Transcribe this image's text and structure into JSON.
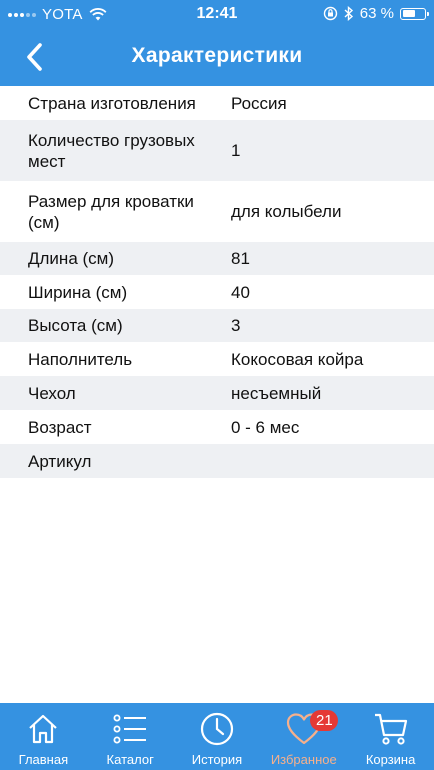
{
  "status_bar": {
    "carrier": "YOTA",
    "time": "12:41",
    "battery_percent": "63 %",
    "battery_level": 0.63
  },
  "header": {
    "title": "Характеристики"
  },
  "specs": [
    {
      "label": "Страна изготовления",
      "value": "Россия"
    },
    {
      "label": "Количество грузовых мест",
      "value": "1"
    },
    {
      "label": "Размер для кроватки (см)",
      "value": "для колыбели"
    },
    {
      "label": "Длина (см)",
      "value": "81"
    },
    {
      "label": "Ширина (см)",
      "value": "40"
    },
    {
      "label": "Высота (см)",
      "value": "3"
    },
    {
      "label": "Наполнитель",
      "value": "Кокосовая койра"
    },
    {
      "label": "Чехол",
      "value": "несъемный"
    },
    {
      "label": "Возраст",
      "value": "0 - 6 мес"
    },
    {
      "label": "Артикул",
      "value": ""
    }
  ],
  "tabbar": {
    "items": [
      {
        "label": "Главная",
        "icon": "home-icon"
      },
      {
        "label": "Каталог",
        "icon": "list-icon"
      },
      {
        "label": "История",
        "icon": "clock-icon"
      },
      {
        "label": "Избранное",
        "icon": "heart-icon",
        "badge": "21",
        "active": true
      },
      {
        "label": "Корзина",
        "icon": "cart-icon"
      }
    ]
  },
  "colors": {
    "primary": "#3592e1",
    "active_tab": "#f6b08c",
    "badge": "#e53935",
    "alt_row": "#eef0f3"
  }
}
